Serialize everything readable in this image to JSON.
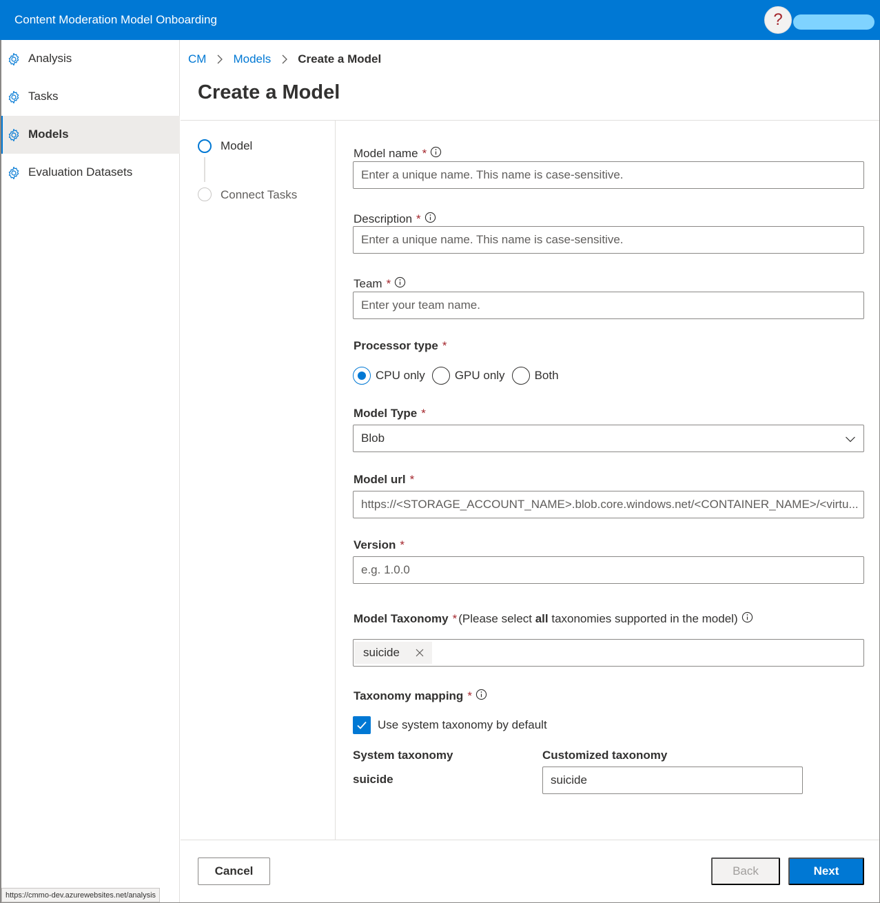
{
  "app": {
    "title": "Content Moderation Model Onboarding",
    "help_glyph": "?"
  },
  "sidebar": {
    "items": [
      {
        "label": "Analysis",
        "icon": "gear-icon",
        "active": false
      },
      {
        "label": "Tasks",
        "icon": "gear-icon",
        "active": false
      },
      {
        "label": "Models",
        "icon": "gear-icon",
        "active": true
      },
      {
        "label": "Evaluation Datasets",
        "icon": "gear-icon",
        "active": false
      }
    ]
  },
  "breadcrumb": {
    "items": [
      "CM",
      "Models"
    ],
    "current": "Create a Model"
  },
  "page": {
    "title": "Create a Model"
  },
  "steps": [
    {
      "label": "Model",
      "active": true
    },
    {
      "label": "Connect Tasks",
      "active": false
    }
  ],
  "form": {
    "model_name": {
      "label": "Model name",
      "required": "*",
      "placeholder": "Enter a unique name. This name is case-sensitive.",
      "value": ""
    },
    "description": {
      "label": "Description",
      "required": "*",
      "placeholder": "Enter a unique name. This name is case-sensitive.",
      "value": ""
    },
    "team": {
      "label": "Team",
      "required": "*",
      "placeholder": "Enter your team name.",
      "value": ""
    },
    "processor_type": {
      "label": "Processor type",
      "required": "*",
      "options": [
        "CPU only",
        "GPU only",
        "Both"
      ],
      "selected": "CPU only"
    },
    "model_type": {
      "label": "Model Type",
      "required": "*",
      "value": "Blob"
    },
    "model_url": {
      "label": "Model url",
      "required": "*",
      "value": "https://<STORAGE_ACCOUNT_NAME>.blob.core.windows.net/<CONTAINER_NAME>/<virtu..."
    },
    "version": {
      "label": "Version",
      "required": "*",
      "placeholder": "e.g. 1.0.0",
      "value": ""
    },
    "model_taxonomy": {
      "label": "Model Taxonomy",
      "required": "*",
      "hint_before": "(Please select ",
      "hint_bold": "all",
      "hint_after": " taxonomies supported in the model)",
      "tags": [
        "suicide"
      ]
    },
    "taxonomy_mapping": {
      "label": "Taxonomy mapping",
      "required": "*",
      "checkbox_label": "Use system taxonomy by default",
      "checked": true,
      "system_header": "System taxonomy",
      "custom_header": "Customized taxonomy",
      "rows": [
        {
          "system": "suicide",
          "custom": "suicide"
        }
      ]
    }
  },
  "footer": {
    "cancel_label": "Cancel",
    "back_label": "Back",
    "next_label": "Next"
  },
  "status_bar": {
    "url": "https://cmmo-dev.azurewebsites.net/analysis"
  },
  "colors": {
    "brand": "#0078d4",
    "required": "#a4262c",
    "nav_active_bg": "#edebe9",
    "user_pill": "#7fd3ff"
  }
}
